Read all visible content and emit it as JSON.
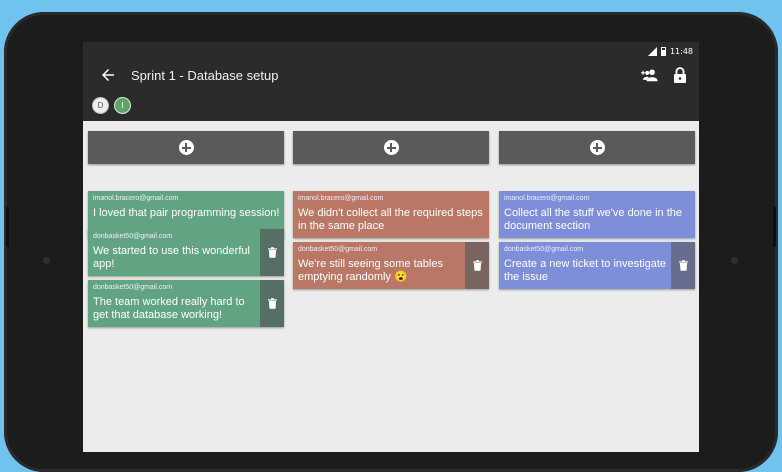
{
  "status": {
    "time": "11:48"
  },
  "app": {
    "title": "Sprint 1 - Database setup"
  },
  "avatars": [
    "D",
    "I"
  ],
  "columns": [
    {
      "color": "green",
      "cards": [
        {
          "email": "imanol.bracero@gmail.com",
          "text": "I loved that pair programming session!",
          "deletable": false
        },
        {
          "email": "donbasket50@gmail.com",
          "text": "We started to use this wonderful app!",
          "deletable": true
        },
        {
          "email": "donbasket50@gmail.com",
          "text": "The team worked really hard to get that database working!",
          "deletable": true
        }
      ]
    },
    {
      "color": "red",
      "cards": [
        {
          "email": "imanol.bracero@gmail.com",
          "text": "We didn't collect all the required steps in the same place",
          "deletable": false
        },
        {
          "email": "donbasket50@gmail.com",
          "text": "We're still seeing some tables emptying randomly 😮",
          "deletable": true
        }
      ]
    },
    {
      "color": "blue",
      "cards": [
        {
          "email": "imanol.bracero@gmail.com",
          "text": "Collect all the stuff we've done in the document section",
          "deletable": false
        },
        {
          "email": "donbasket50@gmail.com",
          "text": "Create a new ticket to investigate the issue",
          "deletable": true
        }
      ]
    }
  ],
  "colors": {
    "green": "#62a482",
    "red": "#bb7766",
    "blue": "#7f8ed8",
    "appbar": "#2b2b2b"
  }
}
